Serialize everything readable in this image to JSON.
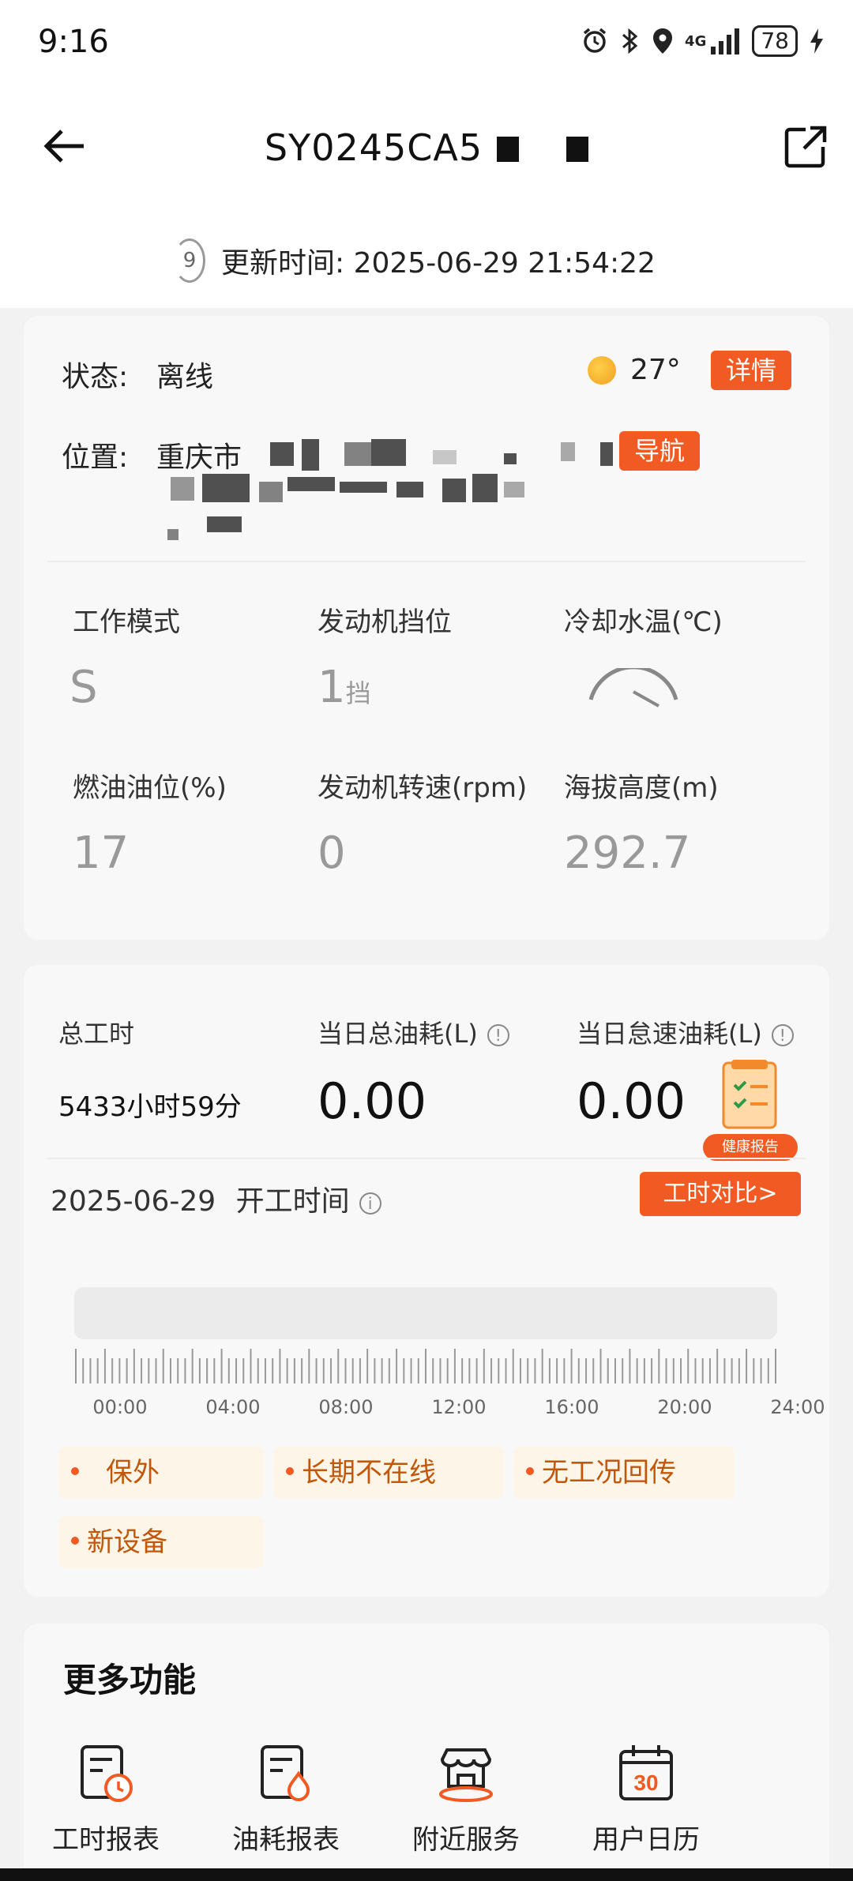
{
  "status_bar": {
    "time": "9:16",
    "battery": "78",
    "network": "4G"
  },
  "header": {
    "title": "SY0245CA5"
  },
  "update": {
    "icon_text": "9",
    "text": "更新时间: 2025-06-29 21:54:22"
  },
  "status_card": {
    "state_label": "状态:",
    "state_value": "离线",
    "temperature": "27°",
    "detail_label": "详情",
    "position_label": "位置:",
    "position_value": "重庆市",
    "navigate_label": "导航",
    "metrics": [
      {
        "label": "工作模式",
        "value": "S",
        "unit": ""
      },
      {
        "label": "发动机挡位",
        "value": "1",
        "unit": "挡"
      },
      {
        "label": "冷却水温(℃)",
        "value": "",
        "unit": ""
      },
      {
        "label": "燃油油位(%)",
        "value": "17",
        "unit": ""
      },
      {
        "label": "发动机转速(rpm)",
        "value": "0",
        "unit": ""
      },
      {
        "label": "海拔高度(m)",
        "value": "292.7",
        "unit": ""
      }
    ]
  },
  "work_card": {
    "total_hours_label": "总工时",
    "total_hours_value": "5433小时59分",
    "daily_fuel_label": "当日总油耗(L)",
    "daily_fuel_value": "0.00",
    "idle_fuel_label": "当日怠速油耗(L)",
    "idle_fuel_value": "0.00",
    "report_badge": "健康报告",
    "date": "2025-06-29",
    "start_time_label": "开工时间",
    "compare_label": "工时对比>",
    "timeline_labels": [
      "00:00",
      "04:00",
      "08:00",
      "12:00",
      "16:00",
      "20:00",
      "24:00"
    ],
    "tags": [
      "保外",
      "长期不在线",
      "无工况回传",
      "新设备"
    ]
  },
  "more": {
    "title": "更多功能",
    "items": [
      {
        "label": "工时报表",
        "icon": "work-report-icon"
      },
      {
        "label": "油耗报表",
        "icon": "fuel-report-icon"
      },
      {
        "label": "附近服务",
        "icon": "nearby-service-icon"
      },
      {
        "label": "用户日历",
        "icon": "calendar-icon",
        "badge": "30"
      }
    ]
  },
  "colors": {
    "accent": "#f15a22",
    "tag_bg": "#fdf6e8",
    "tag_text": "#c2570a"
  }
}
